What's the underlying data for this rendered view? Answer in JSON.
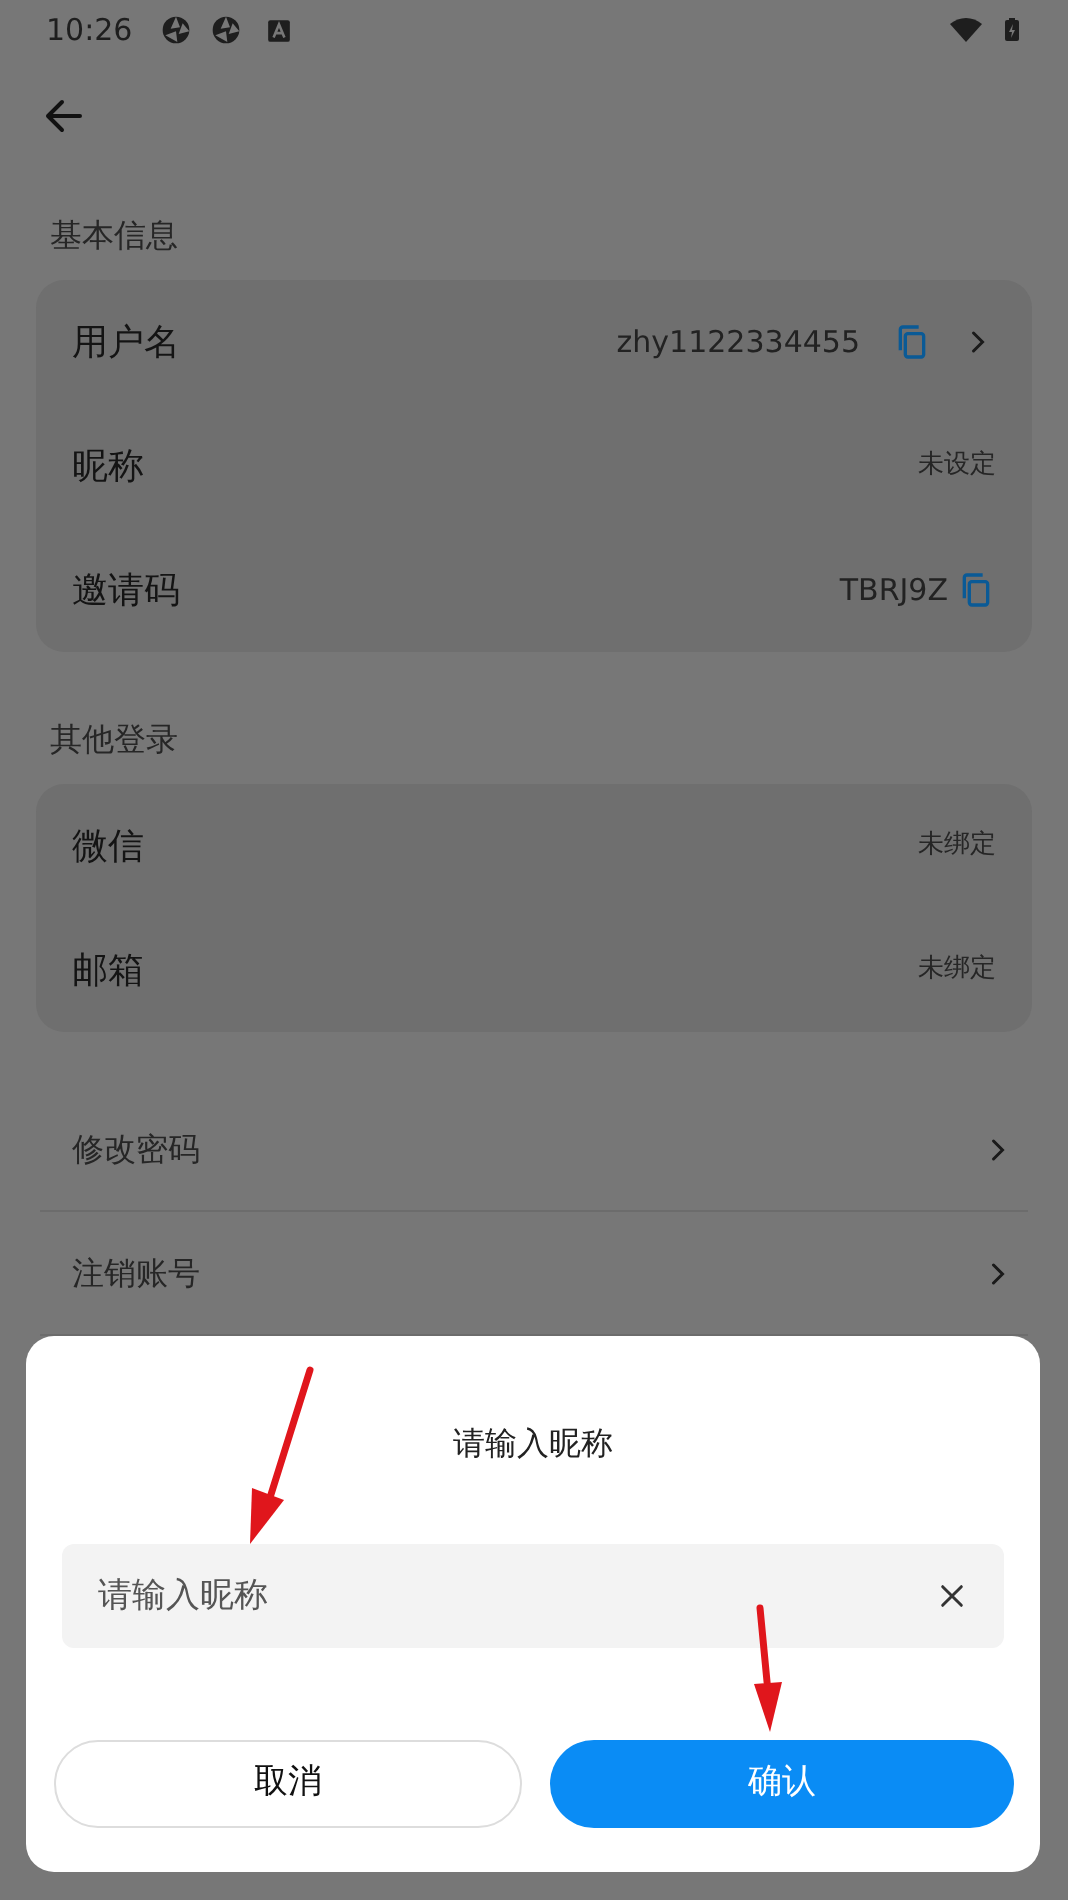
{
  "status_bar": {
    "time": "10:26"
  },
  "sections": [
    {
      "title": "基本信息",
      "rows": [
        {
          "label": "用户名",
          "value": "zhy1122334455",
          "kind": "copy-chevron"
        },
        {
          "label": "昵称",
          "value": "未设定",
          "kind": "plain"
        },
        {
          "label": "邀请码",
          "value": "TBRJ9Z",
          "kind": "copy"
        }
      ]
    },
    {
      "title": "其他登录",
      "rows": [
        {
          "label": "微信",
          "value": "未绑定",
          "kind": "plain"
        },
        {
          "label": "邮箱",
          "value": "未绑定",
          "kind": "plain"
        }
      ]
    }
  ],
  "links": [
    {
      "label": "修改密码"
    },
    {
      "label": "注销账号"
    }
  ],
  "dialog": {
    "title": "请输入昵称",
    "input": {
      "placeholder": "请输入昵称"
    },
    "buttons": [
      {
        "label": "取消",
        "kind": "secondary"
      },
      {
        "label": "确认",
        "kind": "primary"
      }
    ]
  }
}
